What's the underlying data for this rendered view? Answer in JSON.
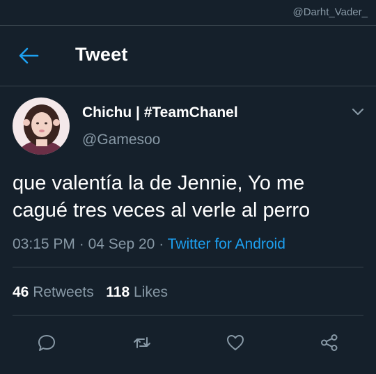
{
  "watermark": "@Darht_Vader_",
  "header": {
    "title": "Tweet",
    "back_icon": "arrow-left-icon"
  },
  "tweet": {
    "author": {
      "display_name": "Chichu | #TeamChanel",
      "handle": "@Gamesoo"
    },
    "text_lines": [
      "que valentía la de Jennie, Yo me",
      "cagué tres veces al verle al perro"
    ],
    "time": "03:15 PM",
    "date": "04 Sep 20",
    "separator": "·",
    "source": "Twitter for Android",
    "stats": {
      "retweets_count": "46",
      "retweets_label": "Retweets",
      "likes_count": "118",
      "likes_label": "Likes"
    },
    "action_icons": [
      "reply-icon",
      "retweet-icon",
      "like-icon",
      "share-icon"
    ]
  },
  "colors": {
    "background": "#15202b",
    "accent": "#1da1f2",
    "secondary_text": "#8899a6",
    "divider": "#38444d"
  }
}
